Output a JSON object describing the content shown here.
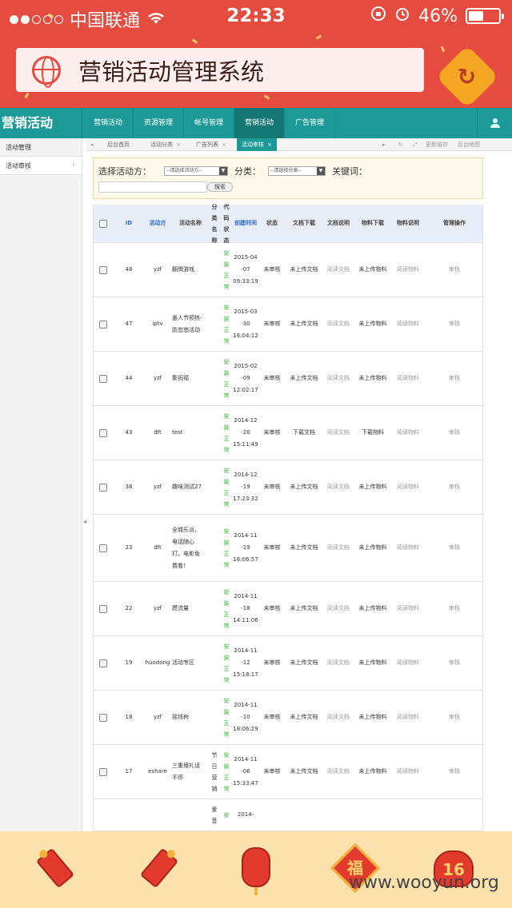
{
  "status_bar": {
    "carrier": "中国联通",
    "time": "22:33",
    "battery": "46%",
    "battery_level": 0.46,
    "signal_dots_filled": 2,
    "signal_dots_total": 5
  },
  "app": {
    "title": "营销活动管理系统",
    "accent": "#e54b3f",
    "icons": {
      "site": "globe-icon",
      "refresh": "refresh-icon"
    }
  },
  "nav": {
    "brand": "营销活动",
    "items": [
      {
        "label": "营销活动"
      },
      {
        "label": "资源管理"
      },
      {
        "label": "帐号管理"
      },
      {
        "label": "营销活动",
        "active": true
      },
      {
        "label": "广告管理"
      }
    ],
    "color": "#1d9a98"
  },
  "sidebar": {
    "items": [
      {
        "label": "活动管理"
      },
      {
        "label": "活动审核",
        "active": true,
        "chevron": "›"
      }
    ]
  },
  "tabs": {
    "prev": "◂",
    "items": [
      {
        "label": "后台首页"
      },
      {
        "label": "活动分类",
        "close": "×"
      },
      {
        "label": "广告列表",
        "close": "×"
      },
      {
        "label": "活动审核",
        "close": "×",
        "active": true
      }
    ],
    "next": "▸",
    "refresh": "↻",
    "expand": "⤢",
    "update_cache": "更新缓存",
    "site_map": "后台地图"
  },
  "filter": {
    "party_label": "选择活动方：",
    "party_select": "--请选择活动方--",
    "category_label": "分类：",
    "category_select": "--请选择分类--",
    "keyword_label": "关键词：",
    "keyword_value": "",
    "search_button": "搜索"
  },
  "table": {
    "headers": {
      "id": "ID",
      "party": "活动方",
      "name": "活动名称",
      "category": "分类名称",
      "code_status": "代码状态",
      "created": "创建时间",
      "status": "状态",
      "doc_download": "文档下载",
      "doc_desc": "文档说明",
      "mat_download": "物料下载",
      "mat_desc": "物料说明",
      "manage": "管理操作"
    },
    "rows": [
      {
        "id": "48",
        "party": "yzf",
        "name": "翻牌游戏",
        "category": "",
        "code": "安装正常",
        "date": "2015-04-07",
        "time": "09:33:19",
        "status": "未审核",
        "doc_dl": "未上传文档",
        "doc_desc": "阅读文档",
        "mat_dl": "未上传物料",
        "mat_desc": "阅读物料",
        "action": "审核"
      },
      {
        "id": "47",
        "party": "iptv",
        "name": "愚人节预热-防忽悠活动",
        "category": "",
        "code": "安装正常",
        "date": "2015-03-30",
        "time": "16:04:12",
        "status": "未审核",
        "doc_dl": "未上传文档",
        "doc_desc": "阅读文档",
        "mat_dl": "未上传物料",
        "mat_desc": "阅读物料",
        "action": "审核"
      },
      {
        "id": "44",
        "party": "yzf",
        "name": "集祝福",
        "category": "",
        "code": "安装正常",
        "date": "2015-02-09",
        "time": "12:02:17",
        "status": "未审核",
        "doc_dl": "未上传文档",
        "doc_desc": "阅读文档",
        "mat_dl": "未上传物料",
        "mat_desc": "阅读物料",
        "action": "审核"
      },
      {
        "id": "43",
        "party": "dft",
        "name": "test",
        "category": "",
        "code": "安装正常",
        "date": "2014-12-20",
        "time": "15:11:49",
        "status": "未审核",
        "doc_dl": "下载文档",
        "doc_desc": "阅读文档",
        "mat_dl": "下载物料",
        "mat_desc": "阅读物料",
        "action": "审核"
      },
      {
        "id": "38",
        "party": "yzf",
        "name": "趣味测试27",
        "category": "",
        "code": "安装正常",
        "date": "2014-12-19",
        "time": "17:23:32",
        "status": "未审核",
        "doc_dl": "未上传文档",
        "doc_desc": "阅读文档",
        "mat_dl": "未上传物料",
        "mat_desc": "阅读物料",
        "action": "审核"
      },
      {
        "id": "23",
        "party": "dft",
        "name": "全城乐派，电话随心打，电影免费看！",
        "category": "",
        "code": "安装正常",
        "date": "2014-11-19",
        "time": "16:06:57",
        "status": "未审核",
        "doc_dl": "未上传文档",
        "doc_desc": "阅读文档",
        "mat_dl": "未上传物料",
        "mat_desc": "阅读物料",
        "action": "审核"
      },
      {
        "id": "22",
        "party": "yzf",
        "name": "攒流量",
        "category": "",
        "code": "安装正常",
        "date": "2014-11-18",
        "time": "14:11:06",
        "status": "未审核",
        "doc_dl": "未上传文档",
        "doc_desc": "阅读文档",
        "mat_dl": "未上传物料",
        "mat_desc": "阅读物料",
        "action": "审核"
      },
      {
        "id": "19",
        "party": "huodong",
        "name": "活动专区",
        "category": "",
        "code": "安装正常",
        "date": "2014-11-12",
        "time": "15:18:17",
        "status": "未审核",
        "doc_dl": "未上传文档",
        "doc_desc": "阅读文档",
        "mat_dl": "未上传物料",
        "mat_desc": "阅读物料",
        "action": "审核"
      },
      {
        "id": "18",
        "party": "yzf",
        "name": "摇钱树",
        "category": "",
        "code": "安装正常",
        "date": "2014-11-10",
        "time": "18:06:29",
        "status": "未审核",
        "doc_dl": "未上传文档",
        "doc_desc": "阅读文档",
        "mat_dl": "未上传物料",
        "mat_desc": "阅读物料",
        "action": "审核"
      },
      {
        "id": "17",
        "party": "eshare",
        "name": "三重壕礼话不停",
        "category": "节日营销",
        "code": "安装正常",
        "date": "2014-11-06",
        "time": "15:33:47",
        "status": "未审核",
        "doc_dl": "未上传文档",
        "doc_desc": "阅读文档",
        "mat_dl": "未上传物料",
        "mat_desc": "阅读物料",
        "action": "审核"
      },
      {
        "id": "",
        "party": "",
        "name": "",
        "category": "爱音",
        "code": "安",
        "date": "2014-",
        "time": "",
        "status": "",
        "doc_dl": "",
        "doc_desc": "",
        "mat_dl": "",
        "mat_desc": "",
        "action": ""
      }
    ]
  },
  "bottom_bar": {
    "icons": [
      "firecracker-icon",
      "firecracker-icon",
      "lantern-icon",
      "fu-icon",
      "red-packet-icon"
    ],
    "fu_char": "福",
    "packet_number": "16"
  },
  "watermark": "www.wooyun.org"
}
